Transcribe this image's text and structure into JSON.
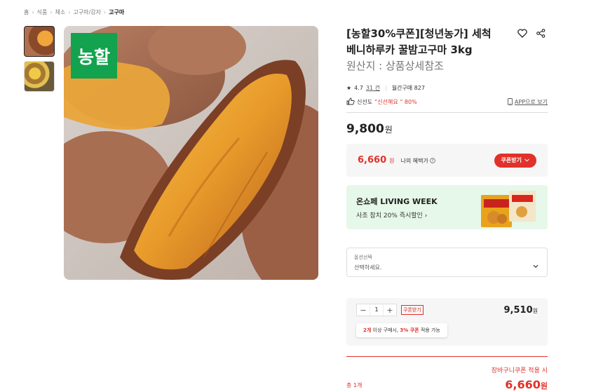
{
  "breadcrumb": [
    "홈",
    "식품",
    "채소",
    "고구마/감자",
    "고구마"
  ],
  "logo_text": "농할",
  "product": {
    "title": "[농할30%쿠폰][청년농가] 세척 베니하루카 꿀밤고구마 3kg",
    "origin": "원산지 : 상품상세참조",
    "rating": "4.7",
    "review_count": "31 건",
    "monthly_purchases": "월간구매 827",
    "freshness_label": "신선도",
    "freshness_value": "“신선해요 ” 80%",
    "app_link": "APP으로 보기",
    "price": "9,800",
    "price_unit": "원"
  },
  "benefit": {
    "price": "6,660",
    "unit": "원",
    "label": "나의 혜택가",
    "coupon_button": "쿠폰받기"
  },
  "promo": {
    "title": "온쇼페 LIVING WEEK",
    "subtitle": "사조 참치 20% 즉시할인",
    "arrow": "›"
  },
  "option": {
    "label": "옵션선택",
    "placeholder": "선택하세요."
  },
  "quantity": {
    "minus": "−",
    "value": "1",
    "plus": "+",
    "coupon_tag": "쿠폰받기",
    "price": "9,510",
    "unit": "원",
    "tip_count": "2개",
    "tip_text1": " 이상 구매시, ",
    "tip_coupon": "3% 쿠폰",
    "tip_text2": " 적용 가능"
  },
  "total": {
    "count": "총 1개",
    "note": "장바구니쿠폰 적용 시",
    "price": "6,660",
    "unit": "원"
  },
  "colors": {
    "accent_red": "#e0322a",
    "brand_green": "#13a24e",
    "promo_bg": "#e6f8e9"
  }
}
